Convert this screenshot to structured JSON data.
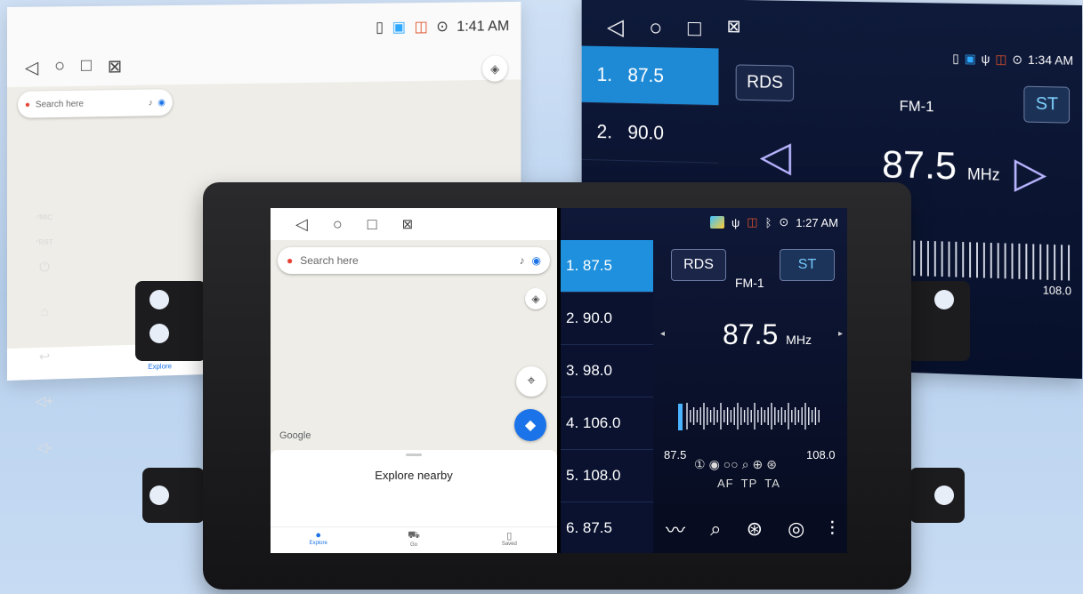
{
  "bg_left": {
    "time": "1:41 AM",
    "search_placeholder": "Search here",
    "explore_label": "Explore"
  },
  "bg_right": {
    "time": "1:34 AM",
    "presets": [
      {
        "num": "1.",
        "freq": "87.5"
      },
      {
        "num": "2.",
        "freq": "90.0"
      }
    ],
    "rds": "RDS",
    "st": "ST",
    "band": "FM-1",
    "freq": "87.5",
    "unit": "MHz",
    "max_freq": "108.0"
  },
  "unit": {
    "mic_label": "MIC",
    "rst_label": "RST"
  },
  "maps": {
    "search_placeholder": "Search here",
    "google_logo": "Google",
    "sheet_title": "Explore nearby",
    "tabs": [
      {
        "label": "Explore"
      },
      {
        "label": "Go"
      },
      {
        "label": "Saved"
      }
    ]
  },
  "radio": {
    "time": "1:27 AM",
    "presets": [
      {
        "label": "1.  87.5"
      },
      {
        "label": "2.  90.0"
      },
      {
        "label": "3.  98.0"
      },
      {
        "label": "4. 106.0"
      },
      {
        "label": "5. 108.0"
      },
      {
        "label": "6.  87.5"
      }
    ],
    "rds": "RDS",
    "st": "ST",
    "band": "FM-1",
    "freq": "87.5",
    "unit": "MHz",
    "min_freq": "87.5",
    "max_freq": "108.0",
    "af": "AF",
    "tp": "TP",
    "ta": "TA",
    "accent_color": "#1e90dd"
  }
}
